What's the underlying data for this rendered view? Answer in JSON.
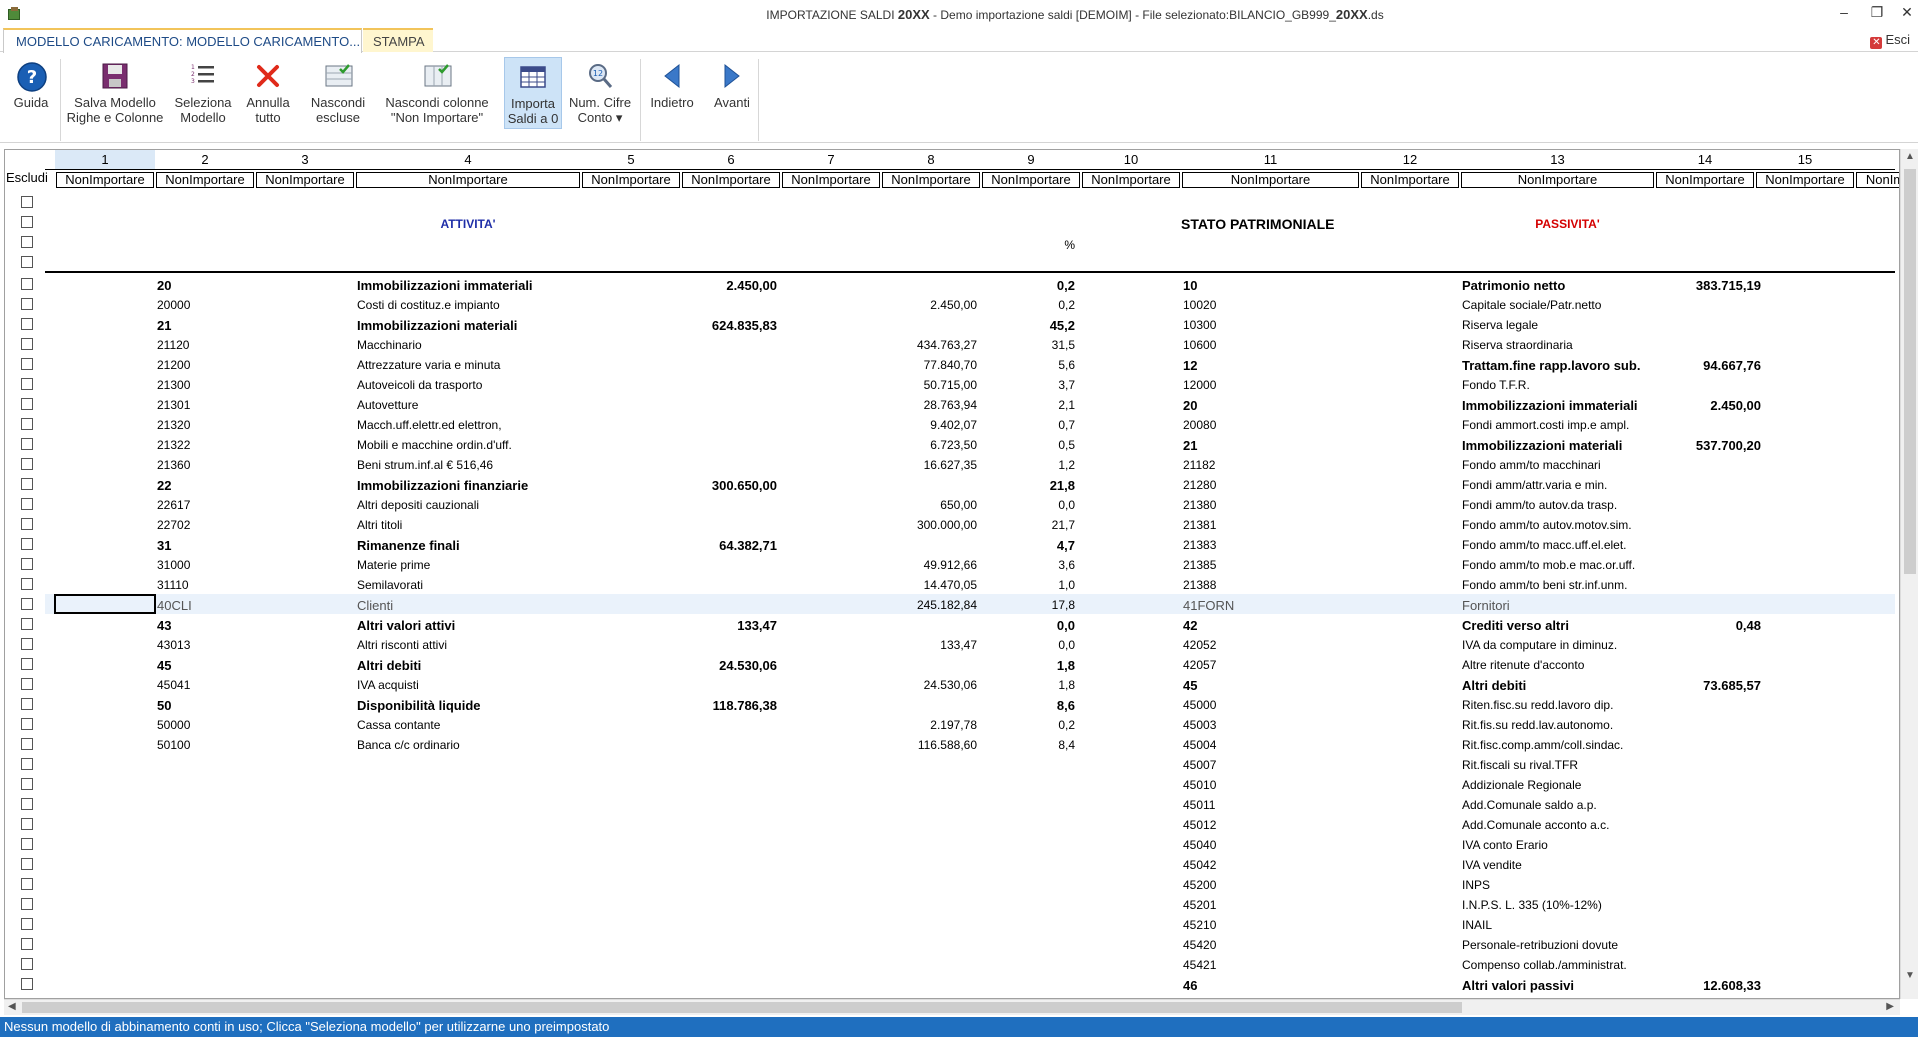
{
  "window": {
    "title_prefix": "IMPORTAZIONE SALDI",
    "title_year": "20XX",
    "title_suffix": "- Demo importazione saldi [DEMOIM] - File selezionato:BILANCIO_GB999_",
    "title_year2": "20XX",
    "title_ext": ".ds",
    "minimize": "–",
    "restore": "❐",
    "close": "✕"
  },
  "tabs": {
    "active": "MODELLO CARICAMENTO: MODELLO CARICAMENTO...",
    "stampa": "STAMPA",
    "esci": "Esci"
  },
  "ribbon": {
    "guida": "Guida",
    "salva": [
      "Salva Modello",
      "Righe e Colonne"
    ],
    "seleziona": [
      "Seleziona",
      "Modello"
    ],
    "annulla": [
      "Annulla",
      "tutto"
    ],
    "nascondi": [
      "Nascondi",
      "escluse"
    ],
    "nascondi_col": [
      "Nascondi colonne",
      "\"Non Importare\""
    ],
    "importa": [
      "Importa",
      "Saldi a 0"
    ],
    "numcifre": [
      "Num. Cifre",
      "Conto ▾"
    ],
    "indietro": "Indietro",
    "avanti": "Avanti"
  },
  "grid": {
    "escludi_label": "Escludi",
    "selector_value": "NonImportare",
    "columns": [
      "1",
      "2",
      "3",
      "4",
      "5",
      "6",
      "7",
      "8",
      "9",
      "10",
      "11",
      "12",
      "13",
      "14",
      "15"
    ],
    "selectors": [
      "NonImportare",
      "NonImportare",
      "NonImportare",
      "NonImportare",
      "NonImportare",
      "NonImportare",
      "NonImportare",
      "NonImportare",
      "NonImportare",
      "NonImportare",
      "NonImportare",
      "NonImportare",
      "NonImportare",
      "NonImportare",
      "NonImportare",
      "NonIm"
    ],
    "headers": {
      "attivita": "ATTIVITA'",
      "stato": "STATO PATRIMONIALE",
      "passivita": "PASSIVITA'",
      "percent": "%"
    },
    "rows": [
      {
        "c2": "20",
        "c4": "Immobilizzazioni immateriali",
        "c6": "2.450,00",
        "c8": "",
        "c9": "0,2",
        "c11": "10",
        "c13": "Patrimonio netto",
        "c15": "383.715,19",
        "bl": true,
        "br": true
      },
      {
        "c2": "20000",
        "c4": "Costi di costituz.e impianto",
        "c6": "",
        "c8": "2.450,00",
        "c9": "0,2",
        "c11": "10020",
        "c13": "Capitale sociale/Patr.netto",
        "c15": ""
      },
      {
        "c2": "21",
        "c4": "Immobilizzazioni materiali",
        "c6": "624.835,83",
        "c8": "",
        "c9": "45,2",
        "c11": "10300",
        "c13": "Riserva legale",
        "c15": "",
        "bl": true
      },
      {
        "c2": "21120",
        "c4": "Macchinario",
        "c6": "",
        "c8": "434.763,27",
        "c9": "31,5",
        "c11": "10600",
        "c13": "Riserva straordinaria",
        "c15": ""
      },
      {
        "c2": "21200",
        "c4": "Attrezzature varia e minuta",
        "c6": "",
        "c8": "77.840,70",
        "c9": "5,6",
        "c11": "12",
        "c13": "Trattam.fine rapp.lavoro sub.",
        "c15": "94.667,76",
        "br": true
      },
      {
        "c2": "21300",
        "c4": "Autoveicoli da trasporto",
        "c6": "",
        "c8": "50.715,00",
        "c9": "3,7",
        "c11": "12000",
        "c13": "Fondo T.F.R.",
        "c15": ""
      },
      {
        "c2": "21301",
        "c4": "Autovetture",
        "c6": "",
        "c8": "28.763,94",
        "c9": "2,1",
        "c11": "20",
        "c13": "Immobilizzazioni immateriali",
        "c15": "2.450,00",
        "br": true
      },
      {
        "c2": "21320",
        "c4": "Macch.uff.elettr.ed elettron,",
        "c6": "",
        "c8": "9.402,07",
        "c9": "0,7",
        "c11": "20080",
        "c13": "Fondi ammort.costi imp.e ampl.",
        "c15": ""
      },
      {
        "c2": "21322",
        "c4": "Mobili e macchine ordin.d'uff.",
        "c6": "",
        "c8": "6.723,50",
        "c9": "0,5",
        "c11": "21",
        "c13": "Immobilizzazioni materiali",
        "c15": "537.700,20",
        "br": true
      },
      {
        "c2": "21360",
        "c4": "Beni strum.inf.al € 516,46",
        "c6": "",
        "c8": "16.627,35",
        "c9": "1,2",
        "c11": "21182",
        "c13": "Fondo amm/to macchinari",
        "c15": ""
      },
      {
        "c2": "22",
        "c4": "Immobilizzazioni finanziarie",
        "c6": "300.650,00",
        "c8": "",
        "c9": "21,8",
        "c11": "21280",
        "c13": "Fondi amm/attr.varia e min.",
        "c15": "",
        "bl": true
      },
      {
        "c2": "22617",
        "c4": "Altri depositi cauzionali",
        "c6": "",
        "c8": "650,00",
        "c9": "0,0",
        "c11": "21380",
        "c13": "Fondi amm/to autov.da trasp.",
        "c15": ""
      },
      {
        "c2": "22702",
        "c4": "Altri titoli",
        "c6": "",
        "c8": "300.000,00",
        "c9": "21,7",
        "c11": "21381",
        "c13": "Fondo amm/to autov.motov.sim.",
        "c15": ""
      },
      {
        "c2": "31",
        "c4": "Rimanenze finali",
        "c6": "64.382,71",
        "c8": "",
        "c9": "4,7",
        "c11": "21383",
        "c13": "Fondo amm/to macc.uff.el.elet.",
        "c15": "",
        "bl": true
      },
      {
        "c2": "31000",
        "c4": "Materie prime",
        "c6": "",
        "c8": "49.912,66",
        "c9": "3,6",
        "c11": "21385",
        "c13": "Fondo amm/to mob.e mac.or.uff.",
        "c15": ""
      },
      {
        "c2": "31110",
        "c4": "Semilavorati",
        "c6": "",
        "c8": "14.470,05",
        "c9": "1,0",
        "c11": "21388",
        "c13": "Fondo amm/to beni str.inf.unm.",
        "c15": ""
      },
      {
        "c2": "40CLI",
        "c4": "Clienti",
        "c6": "",
        "c8": "245.182,84",
        "c9": "17,8",
        "c11": "41FORN",
        "c13": "Fornitori",
        "c15": "",
        "hl": true
      },
      {
        "c2": "43",
        "c4": "Altri valori attivi",
        "c6": "133,47",
        "c8": "",
        "c9": "0,0",
        "c11": "42",
        "c13": "Crediti verso altri",
        "c15": "0,48",
        "bl": true,
        "br": true
      },
      {
        "c2": "43013",
        "c4": "Altri risconti attivi",
        "c6": "",
        "c8": "133,47",
        "c9": "0,0",
        "c11": "42052",
        "c13": "IVA da computare in diminuz.",
        "c15": ""
      },
      {
        "c2": "45",
        "c4": "Altri debiti",
        "c6": "24.530,06",
        "c8": "",
        "c9": "1,8",
        "c11": "42057",
        "c13": "Altre ritenute d'acconto",
        "c15": "",
        "bl": true
      },
      {
        "c2": "45041",
        "c4": "IVA acquisti",
        "c6": "",
        "c8": "24.530,06",
        "c9": "1,8",
        "c11": "45",
        "c13": "Altri debiti",
        "c15": "73.685,57",
        "br": true
      },
      {
        "c2": "50",
        "c4": "Disponibilità liquide",
        "c6": "118.786,38",
        "c8": "",
        "c9": "8,6",
        "c11": "45000",
        "c13": "Riten.fisc.su redd.lavoro dip.",
        "c15": "",
        "bl": true
      },
      {
        "c2": "50000",
        "c4": "Cassa contante",
        "c6": "",
        "c8": "2.197,78",
        "c9": "0,2",
        "c11": "45003",
        "c13": "Rit.fis.su redd.lav.autonomo.",
        "c15": ""
      },
      {
        "c2": "50100",
        "c4": "Banca c/c ordinario",
        "c6": "",
        "c8": "116.588,60",
        "c9": "8,4",
        "c11": "45004",
        "c13": "Rit.fisc.comp.amm/coll.sindac.",
        "c15": ""
      },
      {
        "c2": "",
        "c4": "",
        "c6": "",
        "c8": "",
        "c9": "",
        "c11": "45007",
        "c13": "Rit.fiscali su rival.TFR",
        "c15": ""
      },
      {
        "c2": "",
        "c4": "",
        "c6": "",
        "c8": "",
        "c9": "",
        "c11": "45010",
        "c13": "Addizionale Regionale",
        "c15": ""
      },
      {
        "c2": "",
        "c4": "",
        "c6": "",
        "c8": "",
        "c9": "",
        "c11": "45011",
        "c13": "Add.Comunale saldo a.p.",
        "c15": ""
      },
      {
        "c2": "",
        "c4": "",
        "c6": "",
        "c8": "",
        "c9": "",
        "c11": "45012",
        "c13": "Add.Comunale acconto a.c.",
        "c15": ""
      },
      {
        "c2": "",
        "c4": "",
        "c6": "",
        "c8": "",
        "c9": "",
        "c11": "45040",
        "c13": "IVA conto Erario",
        "c15": ""
      },
      {
        "c2": "",
        "c4": "",
        "c6": "",
        "c8": "",
        "c9": "",
        "c11": "45042",
        "c13": "IVA vendite",
        "c15": ""
      },
      {
        "c2": "",
        "c4": "",
        "c6": "",
        "c8": "",
        "c9": "",
        "c11": "45200",
        "c13": "INPS",
        "c15": ""
      },
      {
        "c2": "",
        "c4": "",
        "c6": "",
        "c8": "",
        "c9": "",
        "c11": "45201",
        "c13": "I.N.P.S. L. 335 (10%-12%)",
        "c15": ""
      },
      {
        "c2": "",
        "c4": "",
        "c6": "",
        "c8": "",
        "c9": "",
        "c11": "45210",
        "c13": "INAIL",
        "c15": ""
      },
      {
        "c2": "",
        "c4": "",
        "c6": "",
        "c8": "",
        "c9": "",
        "c11": "45420",
        "c13": "Personale-retribuzioni dovute",
        "c15": ""
      },
      {
        "c2": "",
        "c4": "",
        "c6": "",
        "c8": "",
        "c9": "",
        "c11": "45421",
        "c13": "Compenso collab./amministrat.",
        "c15": ""
      },
      {
        "c2": "",
        "c4": "",
        "c6": "",
        "c8": "",
        "c9": "",
        "c11": "46",
        "c13": "Altri valori passivi",
        "c15": "12.608,33",
        "br": true
      }
    ]
  },
  "status": {
    "text": "Nessun modello di abbinamento conti in uso; Clicca \"Seleziona modello\" per utilizzarne uno preimpostato"
  },
  "colors": {
    "accent": "#1f6fbf",
    "tab_gold": "#f2c45a",
    "attivita": "#1f2ea8",
    "passivita": "#d40000"
  }
}
